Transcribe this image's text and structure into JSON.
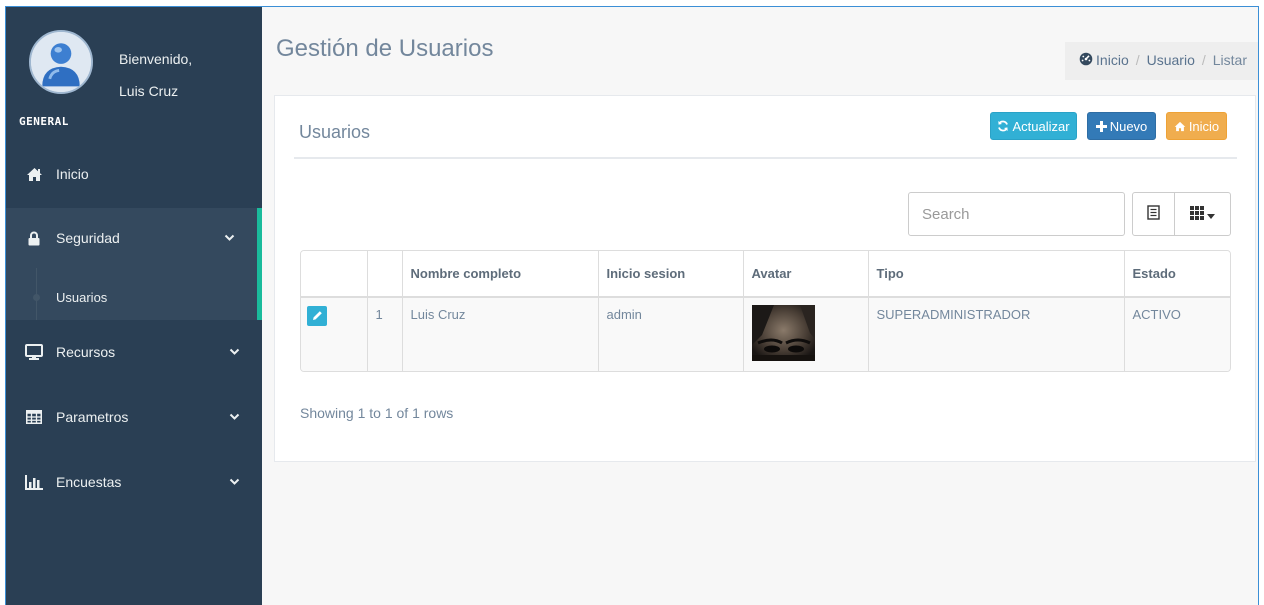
{
  "sidebar": {
    "welcome": "Bienvenido,",
    "user_name": "Luis Cruz",
    "role": "GENERAL",
    "items": [
      {
        "label": "Inicio",
        "icon": "home-icon"
      },
      {
        "label": "Seguridad",
        "icon": "lock-icon"
      },
      {
        "label": "Recursos",
        "icon": "desktop-icon"
      },
      {
        "label": "Parametros",
        "icon": "table-icon"
      },
      {
        "label": "Encuestas",
        "icon": "bar-chart-icon"
      }
    ],
    "submenu": {
      "label": "Usuarios"
    }
  },
  "header": {
    "title": "Gestión de Usuarios",
    "breadcrumb": [
      "Inicio",
      "Usuario",
      "Listar"
    ]
  },
  "panel": {
    "title": "Usuarios",
    "buttons": {
      "refresh": "Actualizar",
      "new": "Nuevo",
      "home": "Inicio"
    }
  },
  "search": {
    "placeholder": "Search"
  },
  "table": {
    "columns": [
      "",
      "",
      "Nombre completo",
      "Inicio sesion",
      "Avatar",
      "Tipo",
      "Estado"
    ],
    "rows": [
      {
        "index": "1",
        "nombre": "Luis Cruz",
        "inicio_sesion": "admin",
        "tipo": "SUPERADMINISTRADOR",
        "estado": "ACTIVO"
      }
    ]
  },
  "pagination": {
    "info": "Showing 1 to 1 of 1 rows"
  },
  "colors": {
    "sidebar": "#2a3f54",
    "accent": "#1abb9c",
    "info": "#31b0d5",
    "primary": "#337ab7",
    "warning": "#f0ad4e"
  }
}
